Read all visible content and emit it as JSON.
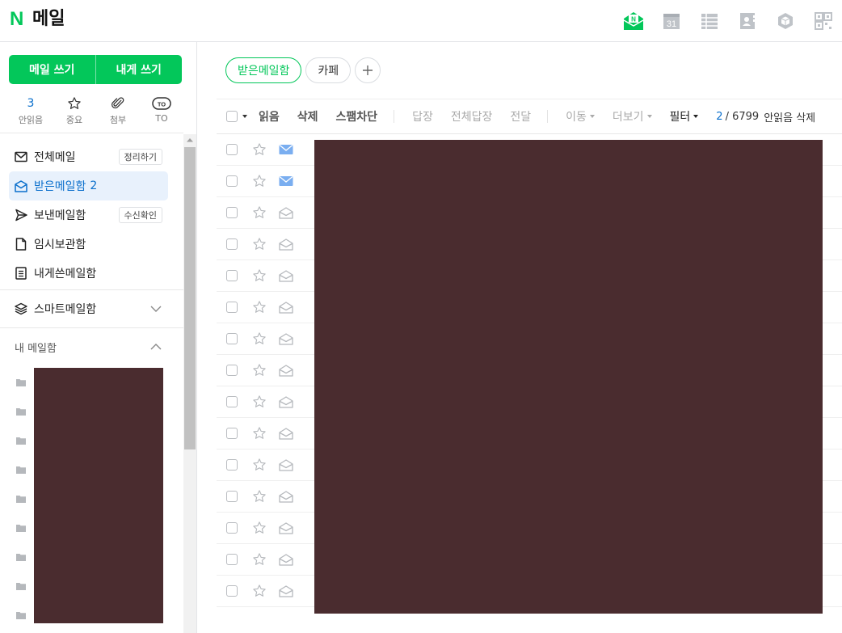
{
  "header": {
    "logo_letter": "N",
    "app_title": "메일",
    "icons": [
      "mail-icon",
      "calendar-icon",
      "list-icon",
      "contacts-icon",
      "box-icon",
      "qr-icon"
    ],
    "calendar_day": "31",
    "brand_color": "#03c75a"
  },
  "sidebar": {
    "write_mail": "메일 쓰기",
    "write_to_me": "내게 쓰기",
    "quick": [
      {
        "value": "3",
        "label": "안읽음"
      },
      {
        "icon": "star-icon",
        "label": "중요"
      },
      {
        "icon": "paperclip-icon",
        "label": "첨부"
      },
      {
        "icon": "to-icon",
        "value": "TO",
        "label": "TO"
      }
    ],
    "folders": [
      {
        "icon": "mail-icon",
        "label": "전체메일",
        "pill": "정리하기"
      },
      {
        "icon": "inbox-icon",
        "label": "받은메일함",
        "count": "2"
      },
      {
        "icon": "send-icon",
        "label": "보낸메일함",
        "pill": "수신확인"
      },
      {
        "icon": "document-icon",
        "label": "임시보관함"
      },
      {
        "icon": "note-icon",
        "label": "내게쓴메일함"
      }
    ],
    "smart_mailbox": "스마트메일함",
    "my_mailbox": "내 메일함"
  },
  "main": {
    "tabs": [
      "받은메일함",
      "카페"
    ],
    "toolbar": {
      "read": "읽음",
      "delete": "삭제",
      "spam": "스팸차단",
      "reply": "답장",
      "reply_all": "전체답장",
      "forward": "전달",
      "move": "이동",
      "more": "더보기",
      "filter": "필터",
      "unread_count": "2",
      "total_count": "/ 6799",
      "trailing": "안읽음 삭제"
    },
    "rows": [
      {
        "envelope": "closed"
      },
      {
        "envelope": "closed"
      },
      {
        "envelope": "open"
      },
      {
        "envelope": "open"
      },
      {
        "envelope": "open"
      },
      {
        "envelope": "open"
      },
      {
        "envelope": "open"
      },
      {
        "envelope": "open"
      },
      {
        "envelope": "open"
      },
      {
        "envelope": "open"
      },
      {
        "envelope": "open"
      },
      {
        "envelope": "open"
      },
      {
        "envelope": "open"
      },
      {
        "envelope": "open"
      },
      {
        "envelope": "open"
      }
    ]
  }
}
